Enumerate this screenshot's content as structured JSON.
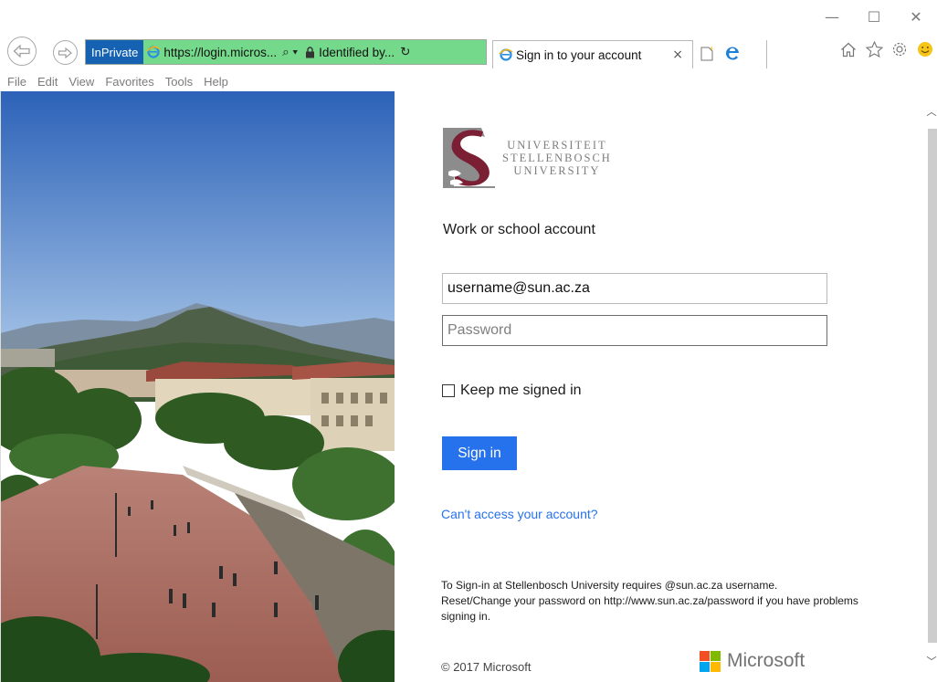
{
  "window": {
    "controls": [
      "—",
      "☐",
      "✕"
    ]
  },
  "browser": {
    "mode_badge": "InPrivate",
    "address": "https://login.micros...",
    "search_glyph": "⌕ ▾",
    "identity": "Identified by...",
    "refresh_glyph": "↻",
    "tab_title": "Sign in to your account",
    "tab_close": "×",
    "menu": [
      "File",
      "Edit",
      "View",
      "Favorites",
      "Tools",
      "Help"
    ]
  },
  "logo": {
    "line1": "UNIVERSITEIT",
    "line2": "STELLENBOSCH",
    "line3": "UNIVERSITY",
    "colors": {
      "gray": "#8c8c8c",
      "maroon": "#7a1f34"
    }
  },
  "signin": {
    "account_type": "Work or school account",
    "username_value": "username@sun.ac.za",
    "password_placeholder": "Password",
    "keep_signed_in": "Keep me signed in",
    "button": "Sign in",
    "cant_access": "Can't access your account?",
    "notice_line1": "To Sign-in at Stellenbosch University requires @sun.ac.za username.",
    "notice_line2": "Reset/Change your password on http://www.sun.ac.za/password if you have problems signing in.",
    "copyright": "© 2017 Microsoft",
    "ms_brand": "Microsoft",
    "accent": "#2672ec"
  }
}
